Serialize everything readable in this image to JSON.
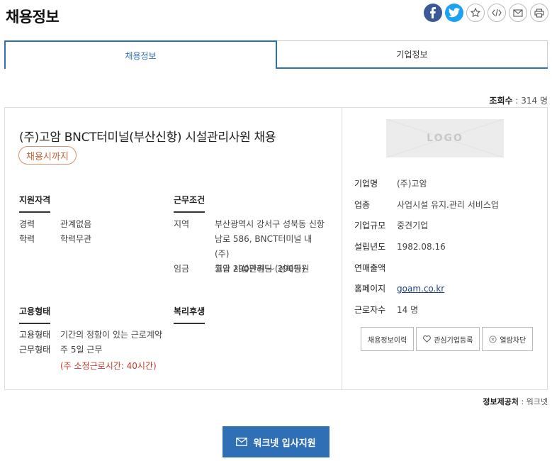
{
  "header": {
    "title": "채용정보"
  },
  "share": {
    "icons": [
      "facebook-icon",
      "twitter-icon",
      "star-icon",
      "code-icon",
      "mail-icon",
      "print-icon"
    ]
  },
  "tabs": [
    {
      "label": "채용정보",
      "active": true
    },
    {
      "label": "기업정보",
      "active": false
    }
  ],
  "views": {
    "label": "조회수",
    "value": ": 314 명"
  },
  "job": {
    "title": "(주)고암 BNCT터미널(부산신항) 시설관리사원 채용",
    "deadline": "채용시까지"
  },
  "sections": {
    "qualification": {
      "heading": "지원자격",
      "items": [
        {
          "label": "경력",
          "value": "관계없음"
        },
        {
          "label": "학력",
          "value": "학력무관"
        }
      ]
    },
    "conditions": {
      "heading": "근무조건",
      "location_label": "지역",
      "location_lines": [
        "부산광역시 강서구 성북동 신항",
        "남로 586, BNCT터미널 내 (주)",
        "고암 시설관리팀 (성북동)"
      ],
      "wage_label": "임금",
      "wage_value": "월급 290만원 ~ 290만원"
    },
    "employment": {
      "heading": "고용형태",
      "items": [
        {
          "label": "고용형태",
          "value": "기간의 정함이 있는 근로계약"
        },
        {
          "label": "근무형태",
          "value": "주 5일 근무"
        }
      ],
      "note": "(주 소정근로시간: 40시간)"
    },
    "welfare": {
      "heading": "복리후생"
    }
  },
  "company": {
    "logo_text": "LOGO",
    "rows": [
      {
        "label": "기업명",
        "value": "(주)고암"
      },
      {
        "label": "업종",
        "value": "사업시설 유지.관리 서비스업"
      },
      {
        "label": "기업규모",
        "value": "중견기업"
      },
      {
        "label": "설립년도",
        "value": "1982.08.16"
      },
      {
        "label": "연매출액",
        "value": ""
      },
      {
        "label": "홈페이지",
        "value": "goam.co.kr"
      },
      {
        "label": "근로자수",
        "value": "14 명"
      }
    ],
    "buttons": {
      "history": "채용정보이력",
      "favorite": "관심기업등록",
      "block": "열람차단"
    }
  },
  "provider": {
    "label": "정보제공처",
    "value": ": 워크넷"
  },
  "apply": {
    "label": "워크넷 입사지원"
  },
  "colors": {
    "accent": "#2f6fb5",
    "deadline": "#c0633b",
    "note": "#c0392b"
  }
}
